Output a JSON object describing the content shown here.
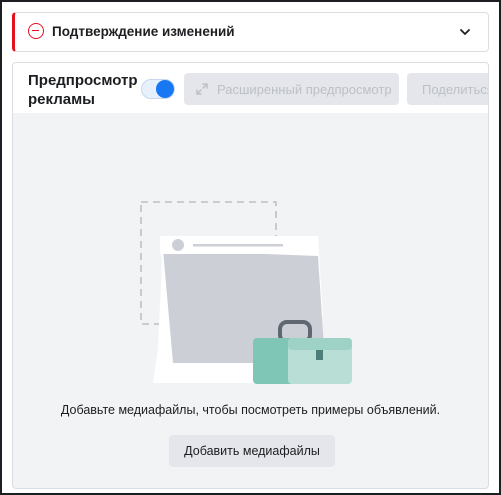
{
  "confirm": {
    "title": "Подтверждение изменений"
  },
  "preview": {
    "label_line1": "Предпросмотр",
    "label_line2": "рекламы",
    "toggle_on": true,
    "expand_label": "Расширенный предпросмотр",
    "share_label": "Поделиться",
    "empty_message": "Добавьте медиафайлы, чтобы посмотреть примеры объявлений.",
    "add_media_label": "Добавить медиафайлы"
  },
  "colors": {
    "alert_red": "#e4111f",
    "toggle_blue": "#1877f2",
    "panel_bg": "#f2f3f5",
    "case_teal": "#7fc6b7"
  }
}
